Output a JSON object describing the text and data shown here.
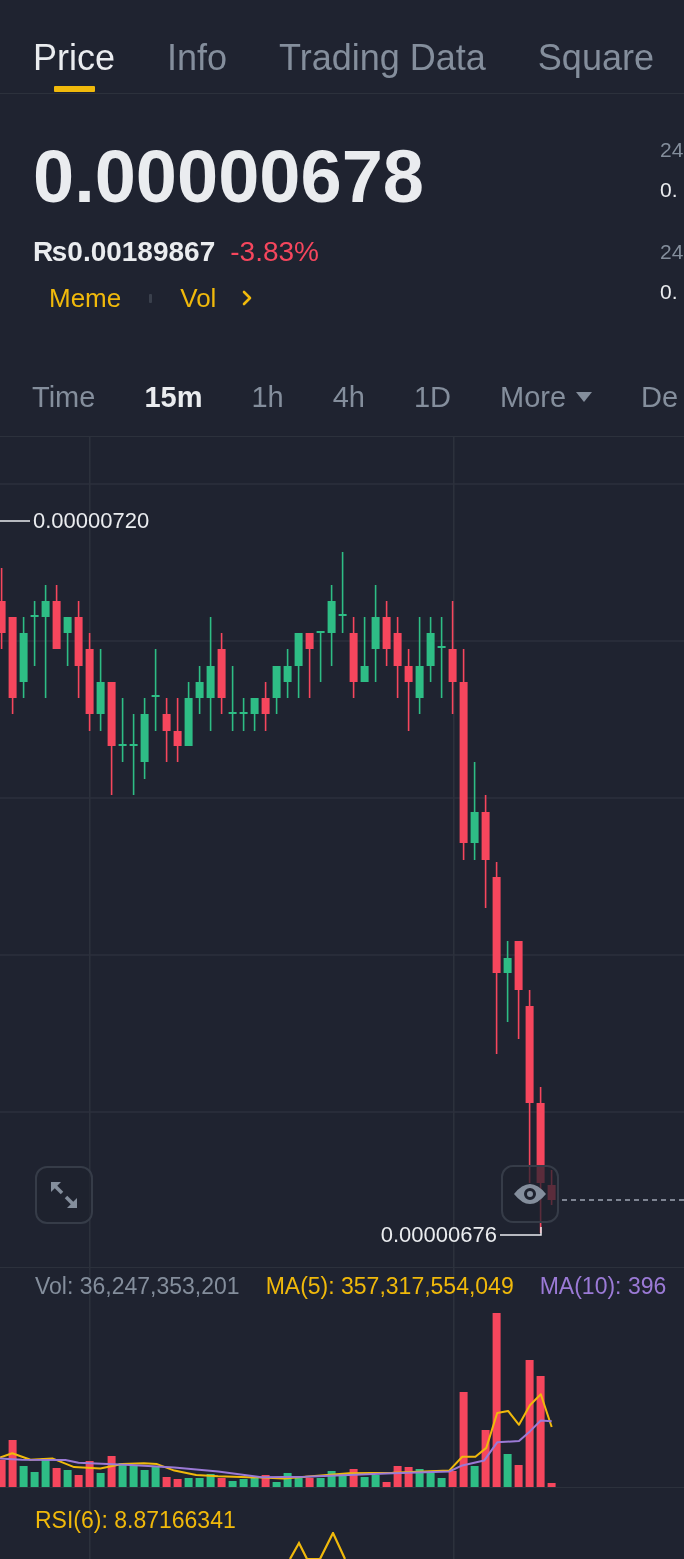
{
  "tabs": [
    {
      "label": "Price",
      "selected": true
    },
    {
      "label": "Info",
      "selected": false
    },
    {
      "label": "Trading Data",
      "selected": false
    },
    {
      "label": "Square",
      "selected": false
    }
  ],
  "price": {
    "last": "0.00000678",
    "fiat": "₨0.00189867",
    "change": "-3.83%",
    "negative": true,
    "tags": [
      "Meme",
      "Vol"
    ]
  },
  "stats": [
    {
      "label": "24",
      "value": "0."
    },
    {
      "label": "24",
      "value": "0."
    }
  ],
  "intervals": [
    {
      "label": "Time",
      "kind": "option",
      "selected": false
    },
    {
      "label": "15m",
      "kind": "option",
      "selected": true
    },
    {
      "label": "1h",
      "kind": "option",
      "selected": false
    },
    {
      "label": "4h",
      "kind": "option",
      "selected": false
    },
    {
      "label": "1D",
      "kind": "option",
      "selected": false
    },
    {
      "label": "More",
      "kind": "menu",
      "selected": false
    },
    {
      "label": "De",
      "kind": "option",
      "selected": false
    }
  ],
  "chart": {
    "high_label": "0.00000720",
    "low_label": "0.00000676"
  },
  "volume": {
    "legend": [
      {
        "text": "Vol: 36,247,353,201",
        "color": "#848e9c"
      },
      {
        "text": "MA(5): 357,317,554,049",
        "color": "#f0b90b"
      },
      {
        "text": "MA(10): 396",
        "color": "#9b7ad6"
      }
    ]
  },
  "rsi": {
    "label": "RSI(6): 8.87166341"
  }
}
